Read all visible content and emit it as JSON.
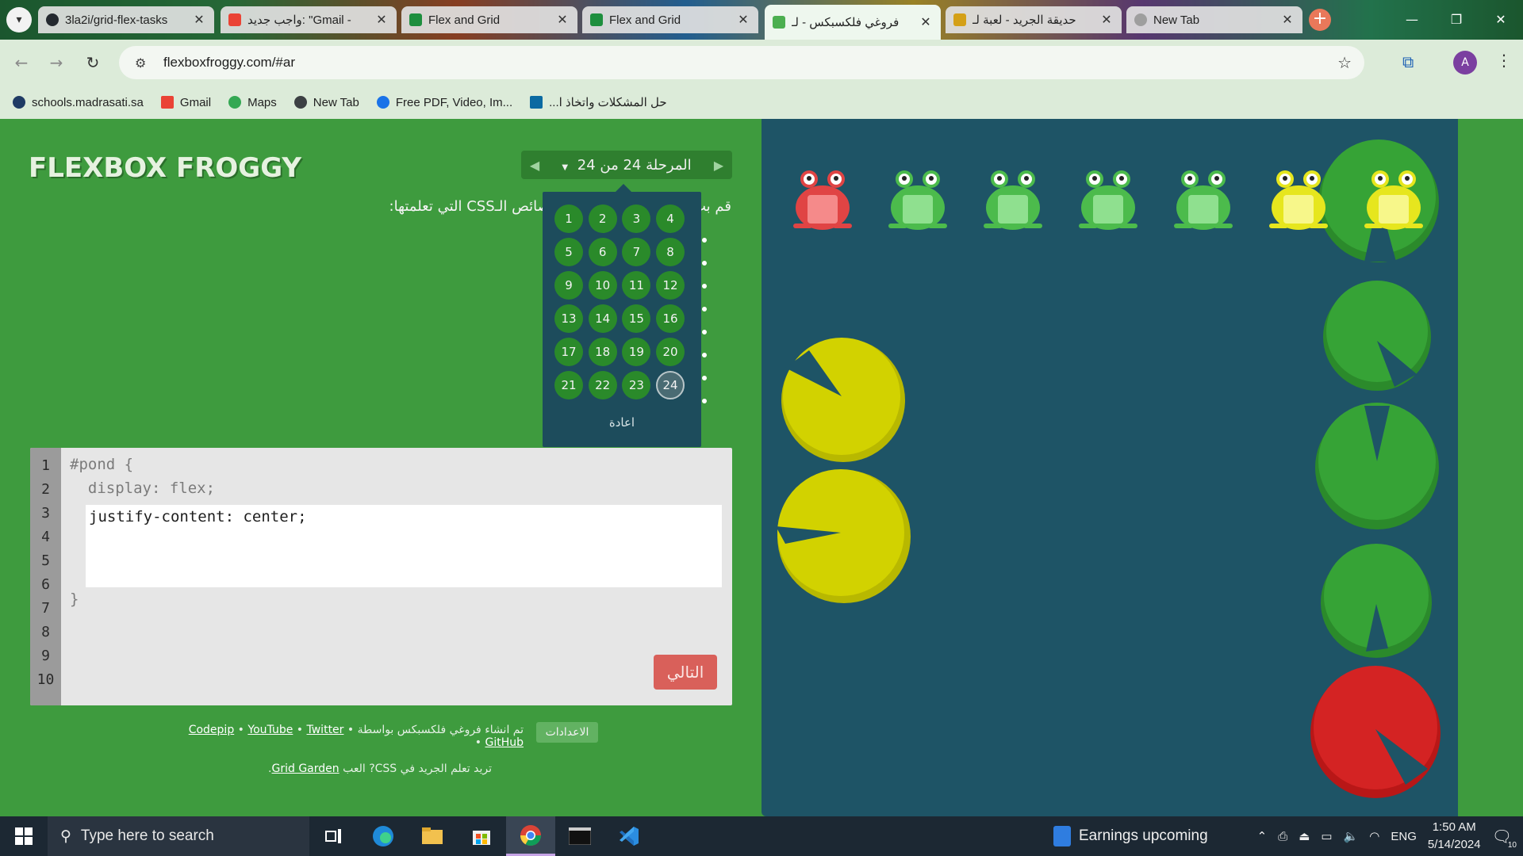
{
  "browser": {
    "tabs": [
      {
        "title": "3la2i/grid-flex-tasks",
        "color": "#24292f"
      },
      {
        "title": "واجب جديد: \"Gmail -",
        "color": "#ea4335"
      },
      {
        "title": "Flex and Grid",
        "color": "#1e8e3e"
      },
      {
        "title": "Flex and Grid",
        "color": "#1e8e3e"
      },
      {
        "title": "فروغي فلكسبكس - لـ",
        "color": "#4caf50"
      },
      {
        "title": "حديقة الجريد - لعبة لـ",
        "color": "#d4a017"
      },
      {
        "title": "New Tab",
        "color": "#9e9e9e"
      }
    ],
    "url": "flexboxfroggy.com/#ar",
    "profile_initial": "A",
    "bookmarks": [
      {
        "label": "schools.madrasati.sa",
        "color": "#1f3b64"
      },
      {
        "label": "Gmail",
        "color": "#ea4335"
      },
      {
        "label": "Maps",
        "color": "#34a853"
      },
      {
        "label": "New Tab",
        "color": "#3c4043"
      },
      {
        "label": "Free PDF, Video, Im...",
        "color": "#1a73e8"
      },
      {
        "label": "حل المشكلات واتخاذ ا...",
        "color": "#0b6aa2"
      }
    ]
  },
  "game": {
    "logo": "FLEXBOX FROGGY",
    "level_label": "المرحلة 24 من 24",
    "instructions": "قم بت... لآخر مرة باستخدام خصائص الـCSS التي تعلمتها:",
    "levels": [
      "1",
      "2",
      "3",
      "4",
      "5",
      "6",
      "7",
      "8",
      "9",
      "10",
      "11",
      "12",
      "13",
      "14",
      "15",
      "16",
      "17",
      "18",
      "19",
      "20",
      "21",
      "22",
      "23",
      "24"
    ],
    "current_level": "24",
    "reset_label": "اعادة",
    "line_numbers": [
      "1",
      "2",
      "3",
      "4",
      "5",
      "6",
      "7",
      "8",
      "9",
      "10"
    ],
    "code": {
      "line1": "#pond {",
      "line2": "  display: flex;",
      "typed": "justify-content: center;",
      "closing": "}"
    },
    "next_label": "التالي",
    "settings_label": "الاعدادات",
    "credits_prefix": "تم انشاء فروغي فلكسبكس بواسطة",
    "credit_links": [
      "Codepip",
      "YouTube",
      "Twitter",
      "GitHub"
    ],
    "promo_text": "تريد تعلم الجريد في CSS? العب",
    "promo_link": "Grid Garden",
    "frogs": [
      "red",
      "green",
      "green",
      "green",
      "green",
      "yellow",
      "yellow"
    ],
    "lilypads": [
      "green",
      "green",
      "green",
      "green",
      "red",
      "yellow",
      "yellow"
    ]
  },
  "taskbar": {
    "search_placeholder": "Type here to search",
    "weather_text": "Earnings upcoming",
    "language": "ENG",
    "time": "1:50 AM",
    "date": "5/14/2024",
    "notification_count": "10"
  }
}
